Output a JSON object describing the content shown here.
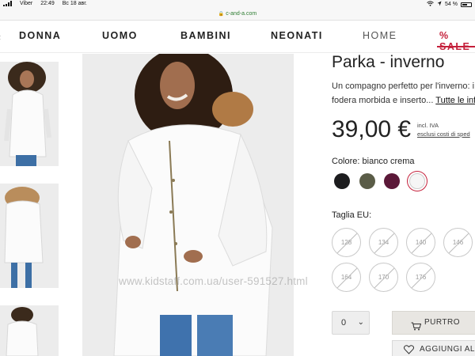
{
  "status_bar": {
    "carrier": "Viber",
    "time": "22:49",
    "date": "Вс 18 авг.",
    "battery": "54 %"
  },
  "url_bar": {
    "domain": "c-and-a.com"
  },
  "nav": {
    "items": [
      {
        "label": "DONNA"
      },
      {
        "label": "UOMO"
      },
      {
        "label": "BAMBINI"
      },
      {
        "label": "NEONATI"
      },
      {
        "label": "HOME"
      },
      {
        "label": "% SALE"
      }
    ],
    "sale_color": "#c41f3a"
  },
  "product": {
    "title": "Parka - inverno",
    "description_line1": "Un compagno perfetto per l'inverno: i",
    "description_line2": "fodera morbida e inserto...",
    "more_link": "Tutte le info",
    "price": "39,00 €",
    "vat_note": "incl. IVA",
    "shipping_note": "esclusi costi di sped",
    "color_label": "Colore: bianco crema",
    "colors": [
      {
        "name": "black",
        "hex": "#1c1c1e"
      },
      {
        "name": "olive",
        "hex": "#5a5c47"
      },
      {
        "name": "burgundy",
        "hex": "#5b1838"
      },
      {
        "name": "bianco crema",
        "hex": "#f6f6f6",
        "selected": true
      }
    ],
    "size_label": "Taglia EU:",
    "sizes": [
      "128",
      "134",
      "140",
      "146",
      "164",
      "170",
      "176"
    ],
    "quantity": "0",
    "add_to_cart": "PURTRO",
    "add_to_wishlist": "AGGIUNGI ALLA"
  },
  "watermark": "www.kidstaff.com.ua/user-591527.html"
}
